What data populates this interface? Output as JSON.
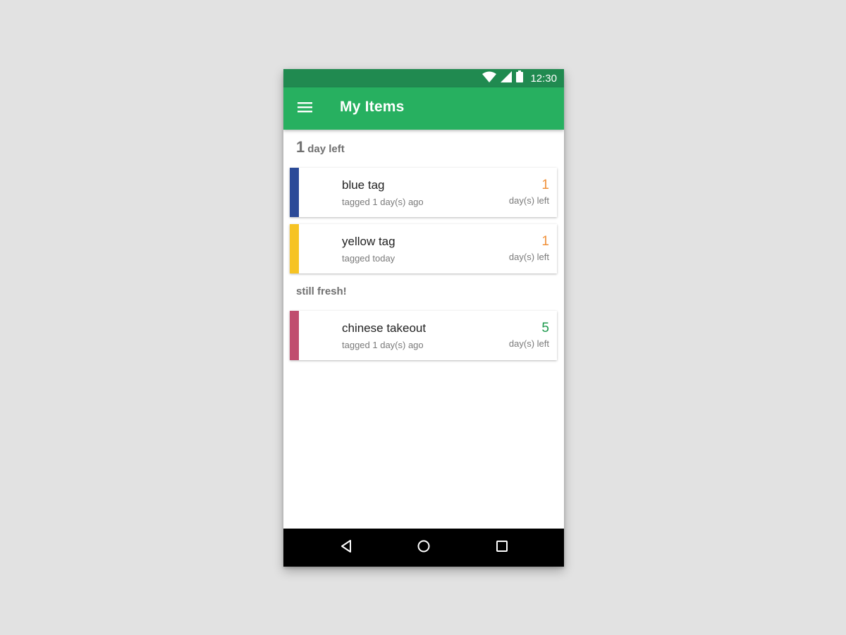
{
  "status_bar": {
    "time": "12:30",
    "icons": [
      "wifi-icon",
      "cell-signal-icon",
      "battery-icon"
    ]
  },
  "app_bar": {
    "title": "My Items",
    "menu_icon": "hamburger-menu-icon"
  },
  "sections": [
    {
      "header_number": "1",
      "header_text": "day left",
      "items": [
        {
          "name": "blue tag",
          "subtitle": "tagged 1 day(s) ago",
          "days": "1",
          "days_label": "day(s) left",
          "tag_color": "#2b4a98",
          "count_color": "#f0913a"
        },
        {
          "name": "yellow tag",
          "subtitle": "tagged today",
          "days": "1",
          "days_label": "day(s) left",
          "tag_color": "#f6c323",
          "count_color": "#f0913a"
        }
      ]
    },
    {
      "header_text": "still fresh!",
      "items": [
        {
          "name": "chinese takeout",
          "subtitle": "tagged 1 day(s) ago",
          "days": "5",
          "days_label": "day(s) left",
          "tag_color": "#c04d6e",
          "count_color": "#1e9a4e"
        }
      ]
    }
  ],
  "nav_bar": {
    "buttons": [
      "back-icon",
      "home-icon",
      "recents-icon"
    ]
  },
  "colors": {
    "status_bar": "#208a50",
    "app_bar": "#27b060",
    "background": "#e2e2e2"
  }
}
